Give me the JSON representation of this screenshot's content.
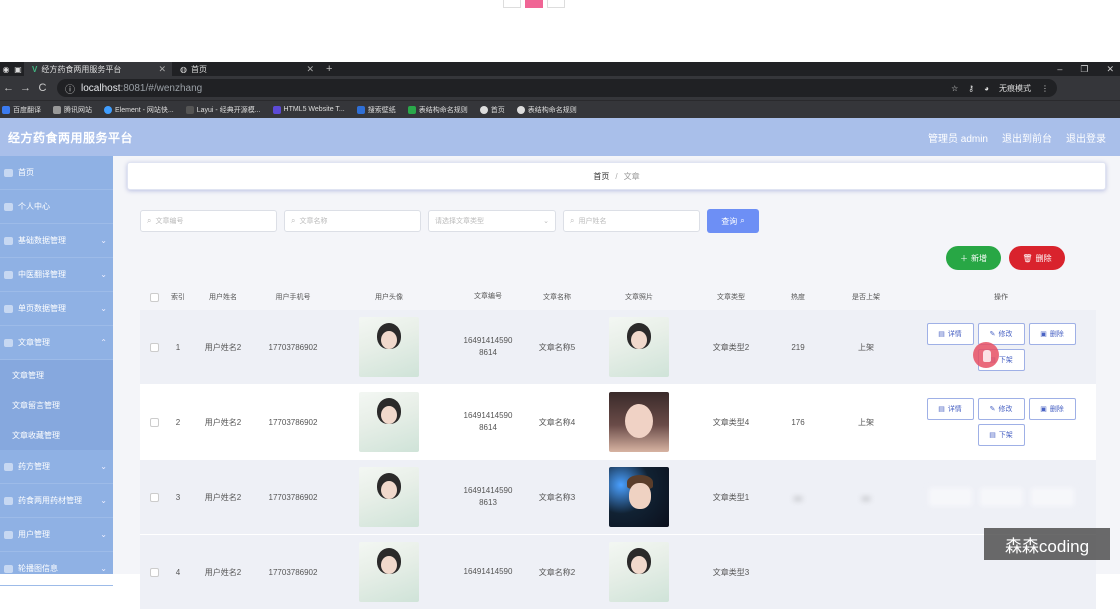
{
  "browser": {
    "tabs": [
      {
        "title": "经方药食两用服务平台",
        "active": true
      },
      {
        "title": "首页",
        "active": false
      }
    ],
    "url_host": "localhost",
    "url_rest": ":8081/#/wenzhang",
    "incognito_label": "无痕模式",
    "bookmarks": [
      "百度翻译",
      "腾讯网站",
      "Element - 网站快...",
      "Layui - 经典开源模...",
      "HTML5 Website T...",
      "搜索壁纸",
      "表结构命名规则",
      "首页",
      "表结构命名规则"
    ]
  },
  "header": {
    "title": "经方药食两用服务平台",
    "links": [
      "管理员 admin",
      "退出到前台",
      "退出登录"
    ]
  },
  "sidebar": {
    "items": [
      {
        "label": "首页",
        "icon": "home-icon"
      },
      {
        "label": "个人中心",
        "icon": "user-icon"
      },
      {
        "label": "基础数据管理",
        "icon": "database-icon"
      },
      {
        "label": "中医翻译管理",
        "icon": "book-icon"
      },
      {
        "label": "单页数据管理",
        "icon": "page-icon"
      },
      {
        "label": "文章管理",
        "icon": "article-icon"
      }
    ],
    "subitems": [
      "文章管理",
      "文章留言管理",
      "文章收藏管理"
    ],
    "items_after": [
      {
        "label": "药方管理",
        "icon": "prescription-icon"
      },
      {
        "label": "药食两用药材管理",
        "icon": "herb-icon"
      },
      {
        "label": "用户管理",
        "icon": "users-icon"
      },
      {
        "label": "轮播图信息",
        "icon": "carousel-icon"
      }
    ]
  },
  "breadcrumb": {
    "home": "首页",
    "separator": "/",
    "current": "文章"
  },
  "filters": {
    "article_no_placeholder": "文章编号",
    "article_name_placeholder": "文章名称",
    "type_placeholder": "请选择文章类型",
    "user_name_placeholder": "用户姓名",
    "search_label": "查询"
  },
  "actions": {
    "add_label": "新增",
    "delete_label": "删除"
  },
  "table": {
    "headers": [
      "索引",
      "用户姓名",
      "用户手机号",
      "用户头像",
      "文章编号",
      "文章名称",
      "文章照片",
      "文章类型",
      "热度",
      "是否上架",
      "操作"
    ],
    "row_buttons": {
      "detail": "详情",
      "edit": "修改",
      "delete": "删除",
      "offshelf": "下架"
    },
    "rows": [
      {
        "index": "1",
        "user_name": "用户姓名2",
        "phone": "17703786902",
        "avatar": "green-portrait",
        "no_line1": "16491414590",
        "no_line2": "8614",
        "name": "文章名称5",
        "photo": "green-portrait",
        "type": "文章类型2",
        "heat": "219",
        "on_shelf": "上架"
      },
      {
        "index": "2",
        "user_name": "用户姓名2",
        "phone": "17703786902",
        "avatar": "green-portrait",
        "no_line1": "16491414590",
        "no_line2": "8614",
        "name": "文章名称4",
        "photo": "girl-portrait",
        "type": "文章类型4",
        "heat": "176",
        "on_shelf": "上架"
      },
      {
        "index": "3",
        "user_name": "用户姓名2",
        "phone": "17703786902",
        "avatar": "green-portrait",
        "no_line1": "16491414590",
        "no_line2": "8613",
        "name": "文章名称3",
        "photo": "boy-portrait",
        "type": "文章类型1",
        "heat": "",
        "on_shelf": ""
      },
      {
        "index": "4",
        "user_name": "用户姓名2",
        "phone": "17703786902",
        "avatar": "green-portrait",
        "no_line1": "16491414590",
        "no_line2": "",
        "name": "文章名称2",
        "photo": "green-portrait",
        "type": "文章类型3",
        "heat": "",
        "on_shelf": ""
      }
    ]
  },
  "watermark": "森森coding"
}
